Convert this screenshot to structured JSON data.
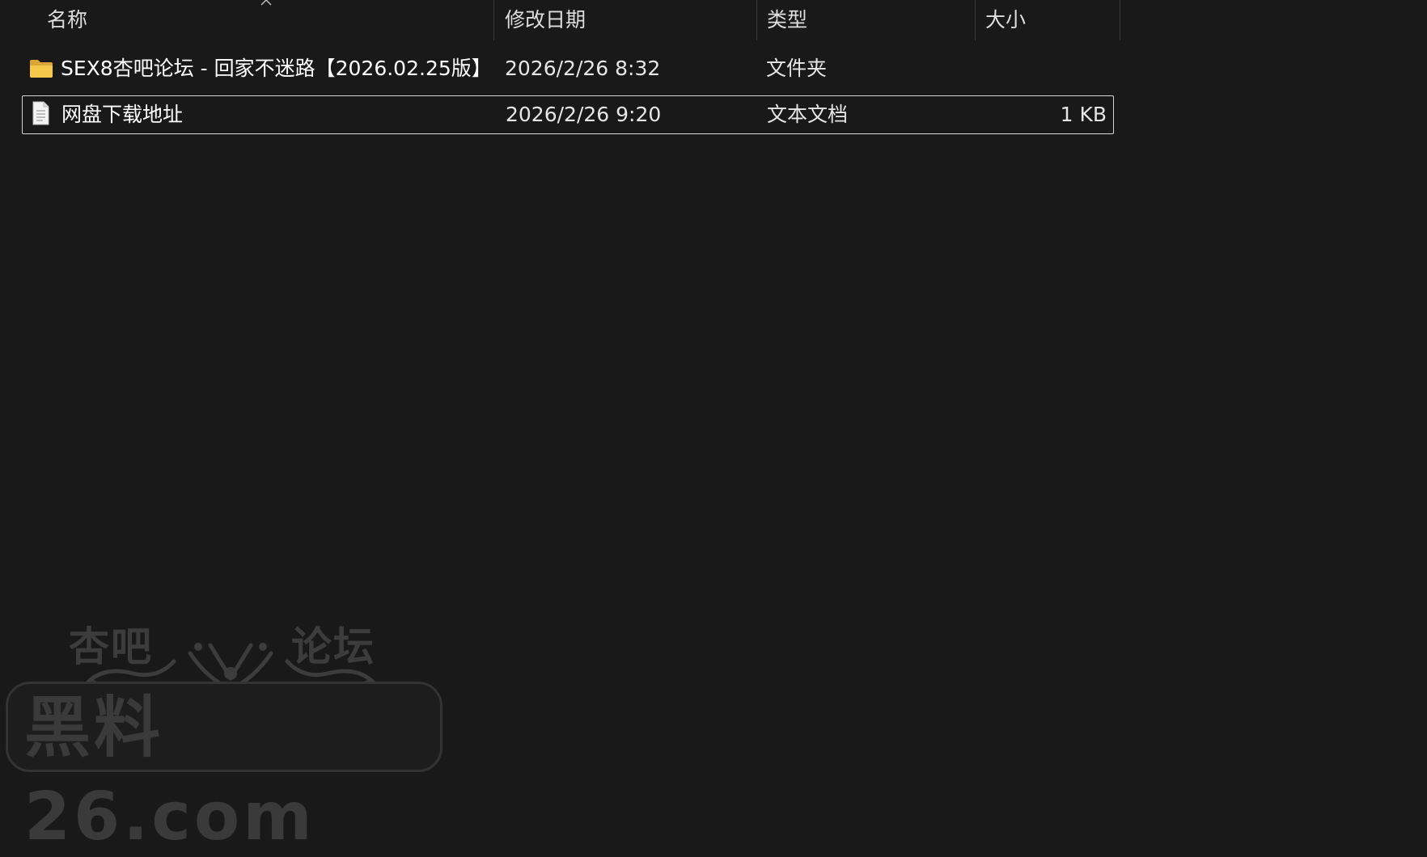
{
  "columns": {
    "name": "名称",
    "modified": "修改日期",
    "type": "类型",
    "size": "大小"
  },
  "files": [
    {
      "icon": "folder-icon",
      "name": "SEX8杏吧论坛 - 回家不迷路【2026.02.25版】",
      "modified": "2026/2/26 8:32",
      "type": "文件夹",
      "size": ""
    },
    {
      "icon": "text-file-icon",
      "name": "网盘下载地址",
      "modified": "2026/2/26 9:20",
      "type": "文本文档",
      "size": "1 KB",
      "selected": true
    }
  ],
  "watermark": {
    "top_left": "杏吧",
    "top_right": "论坛",
    "main": "黑料26.com"
  },
  "colors": {
    "background": "#191919",
    "folder": "#f2c14e",
    "selection_border": "#d6d6d6"
  }
}
